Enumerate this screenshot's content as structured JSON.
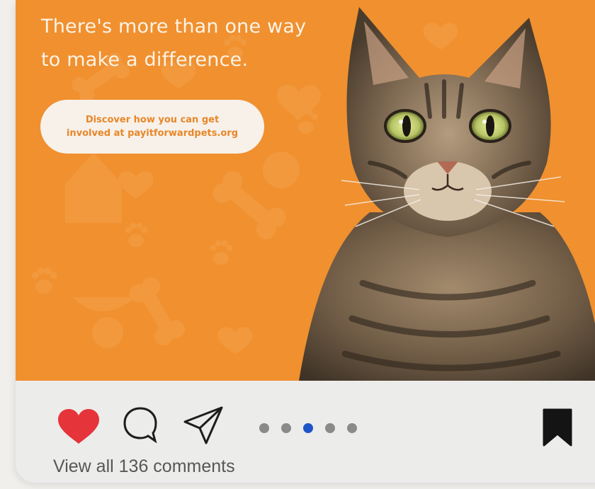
{
  "post": {
    "headline": "There's more than one way\nto make a difference.",
    "cta": "Discover how you can get\ninvolved at payitforwardpets.org",
    "image_alt": "Tabby cat portrait on orange pet-themed background",
    "background_color": "#f0902f"
  },
  "actions": {
    "like_icon": "heart-filled-icon",
    "comment_icon": "speech-bubble-icon",
    "share_icon": "paper-plane-icon",
    "bookmark_icon": "bookmark-filled-icon",
    "like_color": "#e5343a"
  },
  "carousel": {
    "total": 5,
    "active_index": 3
  },
  "comments": {
    "label": "View all 136 comments"
  }
}
